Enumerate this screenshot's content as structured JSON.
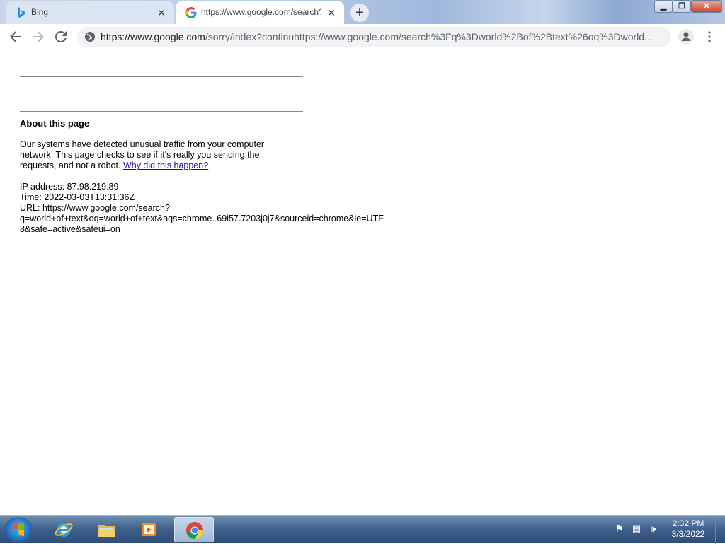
{
  "browser": {
    "tabs": [
      {
        "title": "Bing",
        "favicon": "bing-icon"
      },
      {
        "title": "https://www.google.com/search?",
        "favicon": "google-icon"
      }
    ],
    "new_tab_symbol": "+",
    "close_symbol": "✕",
    "url_host": "https://www.google.com",
    "url_rest": "/sorry/index?continuhttps://www.google.com/search%3Fq%3Dworld%2Bof%2Btext%26oq%3Dworld..."
  },
  "page": {
    "heading": "About this page",
    "message": "Our systems have detected unusual traffic from your computer network. This page checks to see if it's really you sending the requests, and not a robot.",
    "link_text": "Why did this happen?",
    "ip_line": "IP address: 87.98.219.89",
    "time_line": "Time: 2022-03-03T13:31:36Z",
    "url_line_1": "URL: https://www.google.com/search?",
    "url_line_2": "q=world+of+text&oq=world+of+text&aqs=chrome..69i57.7203j0j7&sourceid=chrome&ie=UTF-",
    "url_line_3": "8&safe=active&safeui=on"
  },
  "taskbar": {
    "apps": [
      "internet-explorer",
      "windows-explorer",
      "media-player",
      "chrome"
    ],
    "clock_time": "2:32 PM",
    "clock_date": "3/3/2022"
  },
  "colors": {
    "link": "#1a0dab",
    "taskbar": "#2f4e78"
  }
}
